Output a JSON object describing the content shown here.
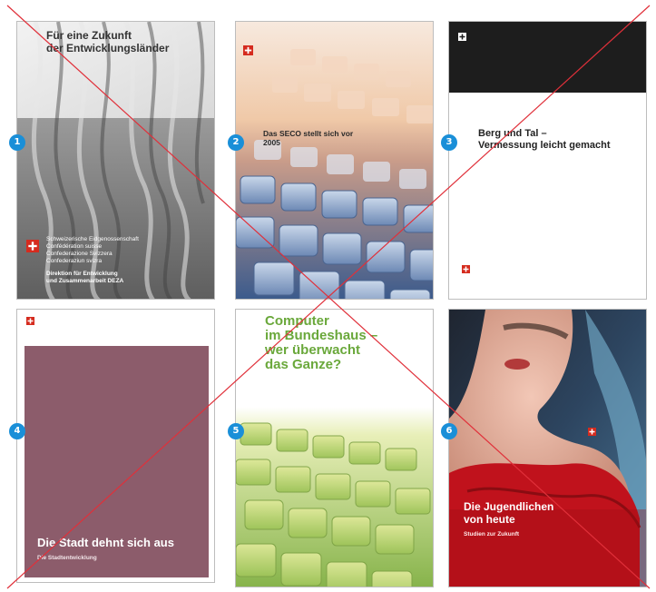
{
  "covers": [
    {
      "number": "1",
      "title": "Für eine Zukunft der Entwicklungsländer",
      "title_line1": "Für eine Zukunft",
      "title_line2": "der Entwicklungsländer",
      "org_line1": "Schweizerische Eidgenossenschaft",
      "org_line2": "Confédération suisse",
      "org_line3": "Confederazione Svizzera",
      "org_line4": "Confederaziun svizra",
      "dept_line1": "Direktion für Entwicklung",
      "dept_line2": "und Zusammenarbeit DEZA"
    },
    {
      "number": "2",
      "title_line1": "Das SECO stellt sich vor",
      "title_line2": "2005"
    },
    {
      "number": "3",
      "title_line1": "Berg und Tal –",
      "title_line2": "Vermessung leicht gemacht"
    },
    {
      "number": "4",
      "title": "Die Stadt dehnt sich aus",
      "subtitle": "Die Stadtentwicklung"
    },
    {
      "number": "5",
      "title_line1": "Computer",
      "title_line2": "im Bundeshaus –",
      "title_line3": "wer überwacht",
      "title_line4": "das Ganze?"
    },
    {
      "number": "6",
      "title_line1": "Die Jugendlichen",
      "title_line2": "von heute",
      "subtitle": "Studien zur Zukunft"
    }
  ],
  "colors": {
    "badge": "#1a8fd8",
    "cross_lines": "#e0303a",
    "swiss_red": "#d52b1e",
    "mauve": "#8c5c6b",
    "green_title": "#6aa83b"
  }
}
